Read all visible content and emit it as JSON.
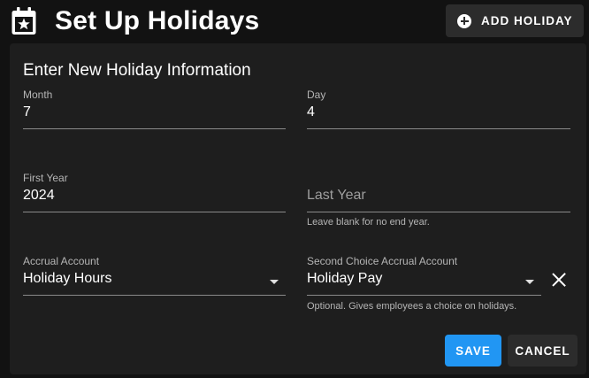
{
  "header": {
    "title": "Set Up Holidays",
    "title_icon": "calendar-star-icon",
    "add_button": {
      "label": "ADD HOLIDAY",
      "icon": "plus-circle-icon"
    }
  },
  "form": {
    "title": "Enter New Holiday Information",
    "month": {
      "label": "Month",
      "value": "7"
    },
    "day": {
      "label": "Day",
      "value": "4"
    },
    "first_year": {
      "label": "First Year",
      "value": "2024"
    },
    "last_year": {
      "placeholder": "Last Year",
      "hint": "Leave blank for no end year."
    },
    "accrual_account": {
      "label": "Accrual Account",
      "value": "Holiday Hours",
      "icon": "caret-down-icon"
    },
    "second_accrual_account": {
      "label": "Second Choice Accrual Account",
      "value": "Holiday Pay",
      "hint": "Optional. Gives employees a choice on holidays.",
      "icon": "caret-down-icon",
      "clear_icon": "close-icon"
    },
    "actions": {
      "save_label": "SAVE",
      "cancel_label": "CANCEL"
    }
  },
  "colors": {
    "background": "#121212",
    "card": "#1e1e1e",
    "primary": "#2196f3",
    "button_dark": "#2c2c2c"
  }
}
